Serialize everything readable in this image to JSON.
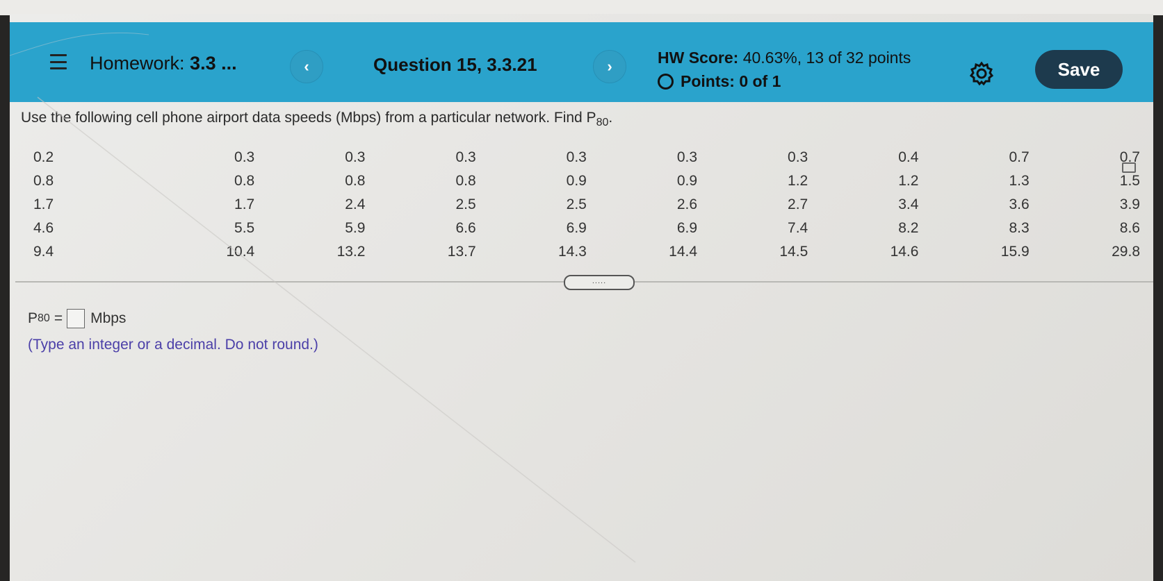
{
  "header": {
    "menu_icon": "hamburger-menu-icon",
    "homework_prefix": "Homework:",
    "homework_name": "3.3 ...",
    "prev_label": "‹",
    "question_label": "Question 15, 3.3.21",
    "next_label": "›",
    "hw_score_label": "HW Score:",
    "hw_score_value": "40.63%, 13 of 32 points",
    "points_label": "Points: 0 of 1",
    "settings_icon": "gear-icon",
    "save_label": "Save",
    "accent_color": "#2aa3cc",
    "save_color": "#1d3a4d"
  },
  "question": {
    "prompt": "Use the following cell phone airport data speeds (Mbps) from a particular network. Find P",
    "prompt_sub": "80",
    "prompt_end": ".",
    "data_rows": [
      [
        "0.2",
        "0.3",
        "0.3",
        "0.3",
        "0.3",
        "0.3",
        "0.3",
        "0.4",
        "0.7",
        "0.7"
      ],
      [
        "0.8",
        "0.8",
        "0.8",
        "0.8",
        "0.9",
        "0.9",
        "1.2",
        "1.2",
        "1.3",
        "1.5"
      ],
      [
        "1.7",
        "1.7",
        "2.4",
        "2.5",
        "2.5",
        "2.6",
        "2.7",
        "3.4",
        "3.6",
        "3.9"
      ],
      [
        "4.6",
        "5.5",
        "5.9",
        "6.6",
        "6.9",
        "6.9",
        "7.4",
        "8.2",
        "8.3",
        "8.6"
      ],
      [
        "9.4",
        "10.4",
        "13.2",
        "13.7",
        "14.3",
        "14.4",
        "14.5",
        "14.6",
        "15.9",
        "29.8"
      ]
    ],
    "copy_icon": "copy-data-icon",
    "divider_handle": "....."
  },
  "answer": {
    "label_main": "P",
    "label_sub": "80",
    "equals": "=",
    "input_value": "",
    "unit": "Mbps",
    "hint": "(Type an integer or a decimal. Do not round.)",
    "hint_color": "#4b3fa8"
  }
}
